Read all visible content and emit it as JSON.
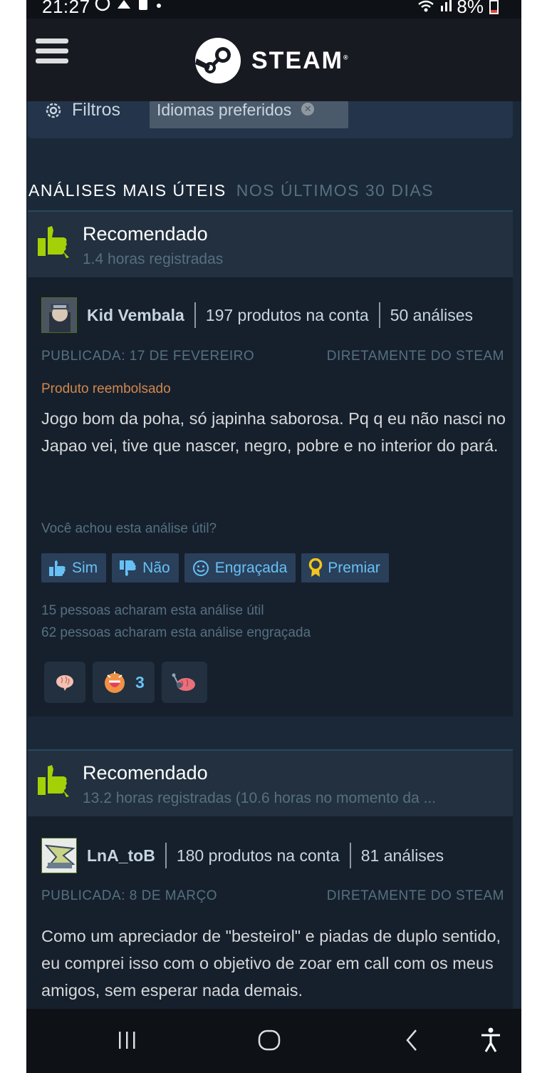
{
  "status_bar": {
    "time": "21:27",
    "battery": "8%",
    "icons": [
      "whatsapp-icon",
      "notification-icon",
      "alert-icon",
      "wifi-icon",
      "signal-icon",
      "battery-icon"
    ]
  },
  "header": {
    "brand": "STEAM"
  },
  "filters": {
    "label": "Filtros",
    "chip": "Idiomas preferidos"
  },
  "section": {
    "title": "ANÁLISES MAIS ÚTEIS",
    "subtitle": "NOS ÚLTIMOS 30 DIAS"
  },
  "reviews": [
    {
      "recommendation": "Recomendado",
      "hours": "1.4 horas registradas",
      "author": "Kid Vembala",
      "products": "197 produtos na conta",
      "reviews_count": "50 análises",
      "posted": "PUBLICADA: 17 DE FEVEREIRO",
      "source": "DIRETAMENTE DO STEAM",
      "refunded": "Produto reembolsado",
      "text": "Jogo bom da poha, só japinha saborosa. Pq q eu não nasci no Japao vei, tive que nascer, negro, pobre e no interior do pará.",
      "helpful_question": "Você achou esta análise útil?",
      "buttons": {
        "yes": "Sim",
        "no": "Não",
        "funny": "Engraçada",
        "award": "Premiar"
      },
      "helpful_stat": "15 pessoas acharam esta análise útil",
      "funny_stat": "62 pessoas acharam esta análise engraçada",
      "award_count": "3"
    },
    {
      "recommendation": "Recomendado",
      "hours": "13.2 horas registradas (10.6 horas no momento da ...",
      "author": "LnA_toB",
      "products": "180 produtos na conta",
      "reviews_count": "81 análises",
      "posted": "PUBLICADA: 8 DE MARÇO",
      "source": "DIRETAMENTE DO STEAM",
      "text": "Como um apreciador de \"besteirol\" e piadas de duplo sentido, eu comprei isso com o objetivo de zoar em call com os meus amigos, sem esperar nada demais."
    }
  ],
  "colors": {
    "page_bg": "#1b2838",
    "header_bg": "#171a21",
    "thumb_green": "#a4d007",
    "link_blue": "#67c1f5",
    "refund_orange": "#d2874c",
    "muted": "#56707f"
  }
}
